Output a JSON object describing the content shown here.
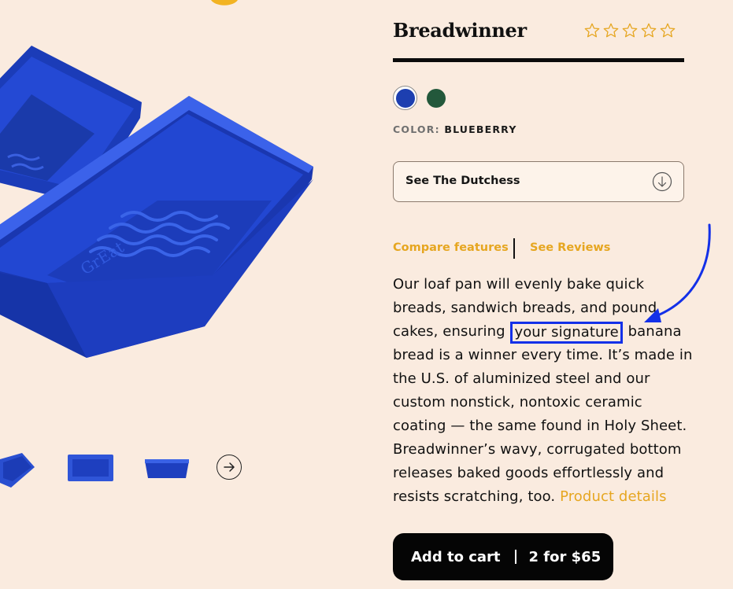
{
  "product": {
    "title": "Breadwinner",
    "rating_stars": 5,
    "rating_filled": 0
  },
  "swatches": [
    {
      "name": "blueberry",
      "color": "#1d3fb0",
      "selected": true
    },
    {
      "name": "green",
      "color": "#23583b",
      "selected": false
    }
  ],
  "color": {
    "label": "COLOR:",
    "value": "BLUEBERRY"
  },
  "dropdown": {
    "label": "See The Dutchess",
    "icon": "arrow-down-circle-icon"
  },
  "links": {
    "compare": "Compare features",
    "reviews": "See Reviews"
  },
  "description": {
    "line1": "Our loaf pan will evenly bake quick",
    "line2": "breads, sandwich breads, and pound",
    "line3_pre": "cakes, ensuring",
    "line3_highlight": "your signature",
    "line3_post": "banana",
    "line4": "bread is a winner every time. It’s made in",
    "line5": "the U.S. of aluminized steel and our",
    "line6": "custom nonstick, nontoxic ceramic",
    "line7": "coating — the same found in Holy Sheet.",
    "line8": "Breadwinner’s wavy, corrugated bottom",
    "line9": "releases baked goods effortlessly and",
    "line10_pre": "resists scratching, too.",
    "details_link": "Product details"
  },
  "cart": {
    "add_label": "Add to cart",
    "deal_label": "2 for $65"
  },
  "colors": {
    "background": "#faebdf",
    "accent": "#e6a620",
    "product_blue": "#1d3fb0",
    "highlight": "#1330e8"
  },
  "thumbnails": [
    "thumbnail-angle",
    "thumbnail-top",
    "thumbnail-side"
  ]
}
